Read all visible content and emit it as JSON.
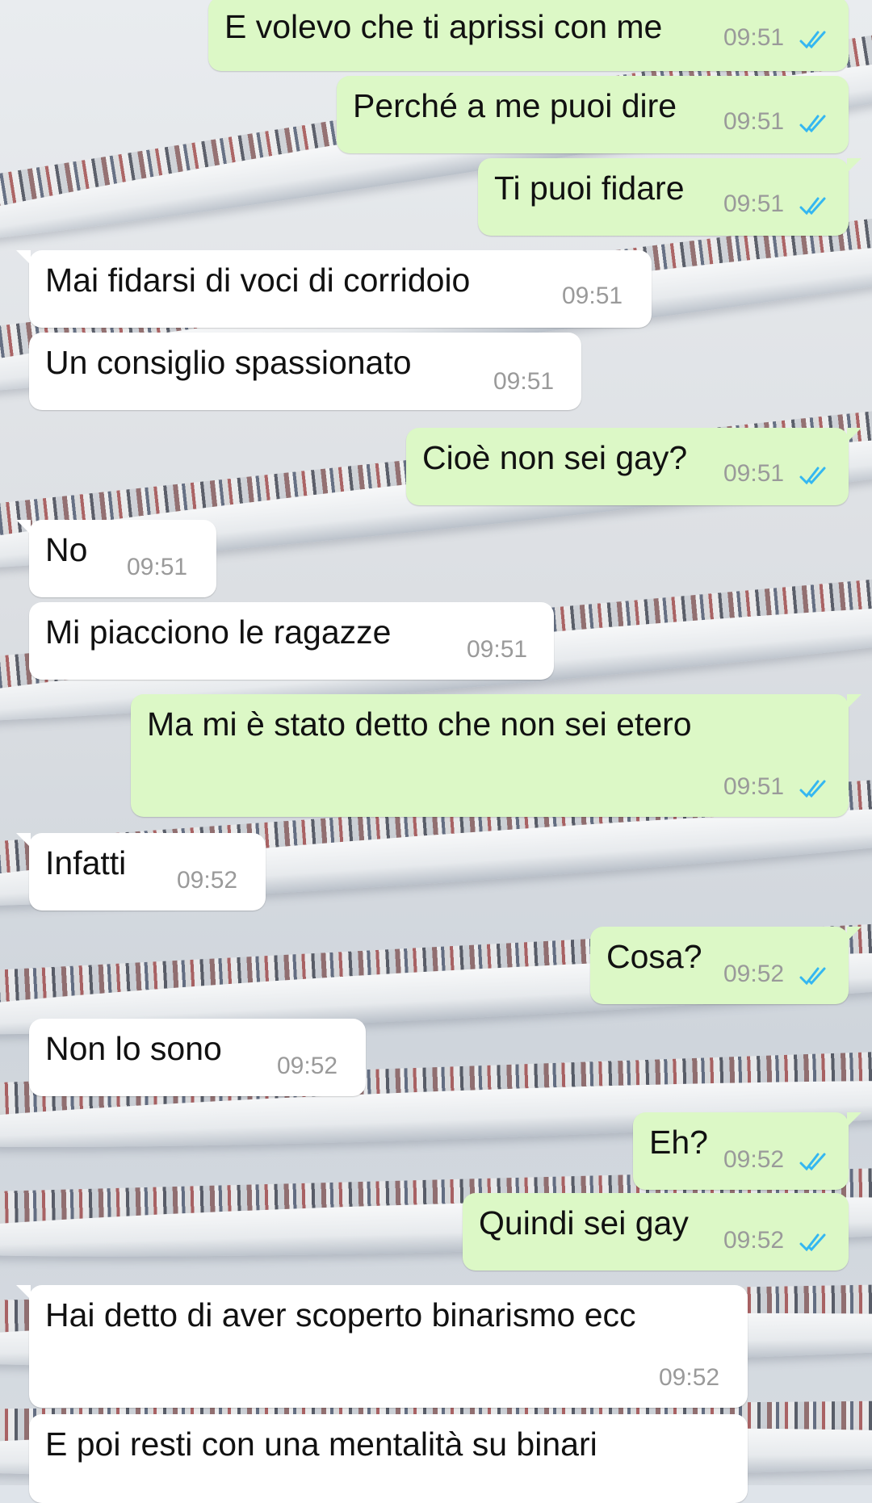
{
  "messages": [
    {
      "dir": "out",
      "text": "E volevo che ti aprissi con me",
      "time": "09:51",
      "status": "read"
    },
    {
      "dir": "out",
      "text": "Perché a me puoi dire",
      "time": "09:51",
      "status": "read"
    },
    {
      "dir": "out",
      "text": "Ti puoi fidare",
      "time": "09:51",
      "status": "read"
    },
    {
      "dir": "in",
      "text": "Mai fidarsi di voci di corridoio",
      "time": "09:51"
    },
    {
      "dir": "in",
      "text": "Un consiglio spassionato",
      "time": "09:51"
    },
    {
      "dir": "out",
      "text": "Cioè non sei gay?",
      "time": "09:51",
      "status": "read"
    },
    {
      "dir": "in",
      "text": "No",
      "time": "09:51"
    },
    {
      "dir": "in",
      "text": "Mi piacciono le ragazze",
      "time": "09:51"
    },
    {
      "dir": "out",
      "text": "Ma mi è stato detto che non sei etero",
      "time": "09:51",
      "status": "read"
    },
    {
      "dir": "in",
      "text": "Infatti",
      "time": "09:52"
    },
    {
      "dir": "out",
      "text": "Cosa?",
      "time": "09:52",
      "status": "read"
    },
    {
      "dir": "in",
      "text": "Non lo sono",
      "time": "09:52"
    },
    {
      "dir": "out",
      "text": "Eh?",
      "time": "09:52",
      "status": "read"
    },
    {
      "dir": "out",
      "text": "Quindi sei gay",
      "time": "09:52",
      "status": "read"
    },
    {
      "dir": "in",
      "text": "Hai detto di aver scoperto binarismo ecc",
      "time": "09:52"
    },
    {
      "dir": "in",
      "text": "E poi resti con una mentalità su binari",
      "time": ""
    }
  ],
  "colors": {
    "outgoing_bubble": "#dcf8c6",
    "incoming_bubble": "#ffffff",
    "timestamp": "#9a9a9a",
    "read_ticks": "#34b7f1"
  },
  "icons": {
    "read_status": "double-check-icon"
  }
}
